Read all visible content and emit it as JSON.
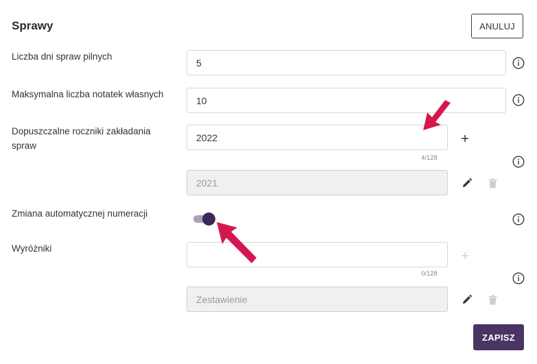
{
  "header": {
    "title": "Sprawy",
    "cancel_label": "ANULUJ"
  },
  "fields": {
    "urgent_days": {
      "label": "Liczba dni spraw pilnych",
      "value": "5"
    },
    "max_notes": {
      "label": "Maksymalna liczba notatek własnych",
      "value": "10"
    },
    "allowed_years": {
      "label": "Dopuszczalne roczniki zakładania spraw",
      "new_value": "2022",
      "counter": "4/128",
      "items": [
        {
          "value": "2021"
        }
      ]
    },
    "auto_numbering": {
      "label": "Zmiana automatycznej numeracji",
      "enabled": true
    },
    "markers": {
      "label": "Wyróżniki",
      "new_value": "",
      "counter": "0/128",
      "items": [
        {
          "value": "Zestawienie"
        }
      ]
    }
  },
  "footer": {
    "save_label": "ZAPISZ"
  },
  "icons": {
    "info": "info-circle-icon",
    "plus": "plus-icon",
    "edit": "pencil-icon",
    "delete": "trash-icon"
  },
  "colors": {
    "primary": "#4a3463",
    "toggle_knob": "#3b2a58",
    "toggle_track": "#a9a3b2",
    "annotation_arrow": "#d4184f",
    "disabled_bg": "#f0f0f0"
  }
}
